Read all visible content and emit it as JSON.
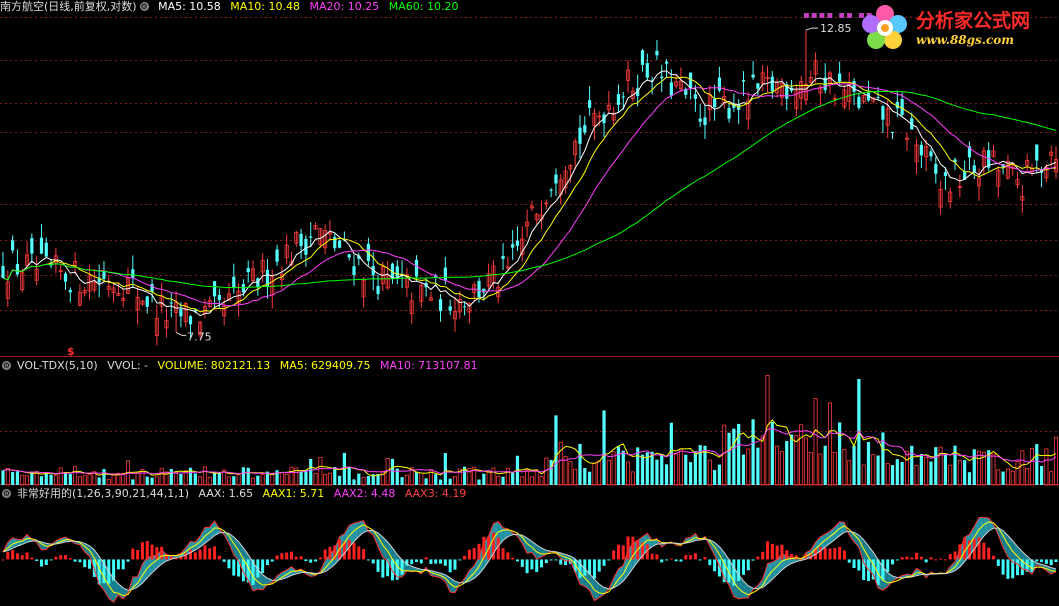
{
  "main_panel": {
    "title": "南方航空(日线,前复权,对数)",
    "indicators": [
      {
        "label": "MA5: 10.58",
        "color": "#ffffff"
      },
      {
        "label": "MA10: 10.48",
        "color": "#ffff00"
      },
      {
        "label": "MA20: 10.25",
        "color": "#ff40ff"
      },
      {
        "label": "MA60: 10.20",
        "color": "#00ff00"
      }
    ],
    "high_label": "12.85",
    "low_label": "7.75",
    "signal_mark": "$"
  },
  "volume_panel": {
    "title": "VOL-TDX(5,10)",
    "indicators": [
      {
        "label": "VVOL: -",
        "color": "#cccccc"
      },
      {
        "label": "VOLUME: 802121.13",
        "color": "#ffff00"
      },
      {
        "label": "MA5: 629409.75",
        "color": "#ffff00"
      },
      {
        "label": "MA10: 713107.81",
        "color": "#ff40ff"
      }
    ]
  },
  "osc_panel": {
    "title": "非常好用的(1,26,3,90,21,44,1,1)",
    "indicators": [
      {
        "label": "AAX: 1.65",
        "color": "#cccccc"
      },
      {
        "label": "AAX1: 5.71",
        "color": "#ffff00"
      },
      {
        "label": "AAX2: 4.48",
        "color": "#ff40ff"
      },
      {
        "label": "AAX3: 4.19",
        "color": "#ff4040"
      }
    ]
  },
  "logo": {
    "title": "分析家公式网",
    "url": "www.88gs.com",
    "icon": "flower-logo-icon"
  },
  "colors": {
    "up": "#ff3c3c",
    "down": "#54ffff",
    "grid": "#8b1a1a",
    "divider": "#a01818",
    "ma5": "#ffffff",
    "ma10": "#ffff00",
    "ma20": "#ff40ff",
    "ma60": "#00ff00"
  },
  "chart_data": [
    {
      "type": "candlestick",
      "scale": "log",
      "ylim": [
        7.5,
        13.2
      ],
      "bars": 220,
      "close_path": [
        [
          0,
          8.7
        ],
        [
          15,
          8.5
        ],
        [
          25,
          8.45
        ],
        [
          35,
          7.95
        ],
        [
          45,
          8.0
        ],
        [
          55,
          8.6
        ],
        [
          65,
          9.2
        ],
        [
          72,
          8.8
        ],
        [
          80,
          8.4
        ],
        [
          95,
          8.2
        ],
        [
          105,
          8.55
        ],
        [
          115,
          10.2
        ],
        [
          125,
          11.3
        ],
        [
          135,
          12.1
        ],
        [
          145,
          11.2
        ],
        [
          152,
          11.4
        ],
        [
          160,
          11.7
        ],
        [
          170,
          11.9
        ],
        [
          178,
          11.4
        ],
        [
          188,
          10.9
        ],
        [
          195,
          9.9
        ],
        [
          205,
          10.3
        ],
        [
          212,
          9.95
        ],
        [
          219,
          10.6
        ]
      ],
      "high": 12.85,
      "low": 7.75,
      "ma_series": [
        {
          "name": "MA5",
          "period": 5,
          "last": 10.58
        },
        {
          "name": "MA10",
          "period": 10,
          "last": 10.48
        },
        {
          "name": "MA20",
          "period": 20,
          "last": 10.25
        },
        {
          "name": "MA60",
          "period": 60,
          "last": 10.2
        }
      ]
    },
    {
      "type": "bar",
      "name": "VOLUME",
      "last": 802121.13,
      "ylim": [
        0,
        1900000
      ],
      "ma_series": [
        {
          "name": "MA5",
          "last": 629409.75
        },
        {
          "name": "MA10",
          "last": 713107.81
        }
      ]
    },
    {
      "type": "bar",
      "name": "AAX",
      "last": 1.65,
      "ylim": [
        -30,
        40
      ],
      "lines": [
        {
          "name": "AAX1",
          "last": 5.71
        },
        {
          "name": "AAX2",
          "last": 4.48
        },
        {
          "name": "AAX3",
          "last": 4.19
        }
      ]
    }
  ]
}
